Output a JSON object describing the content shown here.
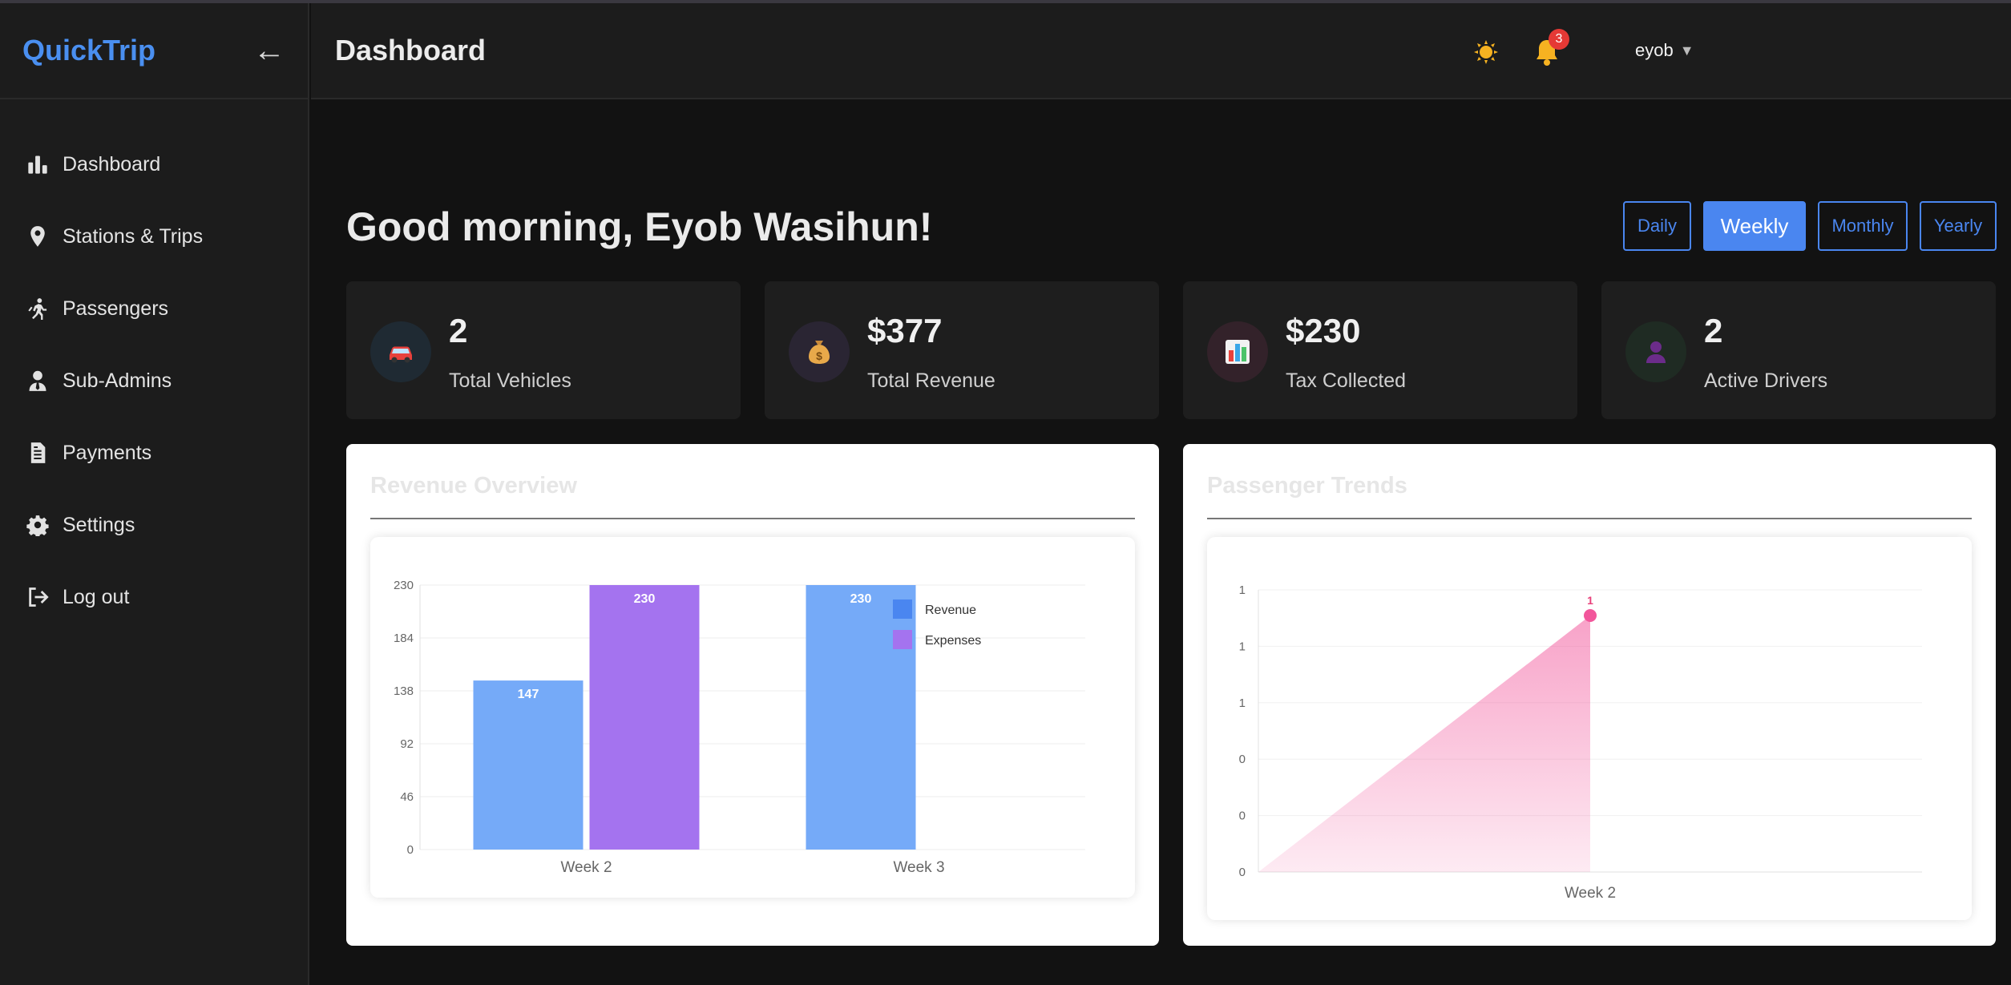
{
  "app": {
    "brand": "QuickTrip",
    "collapse_icon": "arrow-left-icon"
  },
  "sidebar": {
    "items": [
      {
        "label": "Dashboard",
        "icon": "bar-chart-icon"
      },
      {
        "label": "Stations & Trips",
        "icon": "map-pin-icon"
      },
      {
        "label": "Passengers",
        "icon": "walking-person-icon"
      },
      {
        "label": "Sub-Admins",
        "icon": "user-tie-icon"
      },
      {
        "label": "Payments",
        "icon": "document-icon"
      },
      {
        "label": "Settings",
        "icon": "gear-icon"
      },
      {
        "label": "Log out",
        "icon": "logout-icon"
      }
    ]
  },
  "topbar": {
    "title": "Dashboard",
    "notifications_count": "3",
    "username": "eyob",
    "caret": "▼"
  },
  "greeting": "Good morning, Eyob Wasihun!",
  "periods": [
    {
      "label": "Daily",
      "active": false
    },
    {
      "label": "Weekly",
      "active": true
    },
    {
      "label": "Monthly",
      "active": false
    },
    {
      "label": "Yearly",
      "active": false
    }
  ],
  "stats": [
    {
      "value": "2",
      "label": "Total Vehicles",
      "icon": "car-icon"
    },
    {
      "value": "$377",
      "label": "Total Revenue",
      "icon": "money-bag-icon"
    },
    {
      "value": "$230",
      "label": "Tax Collected",
      "icon": "bar-chart-icon"
    },
    {
      "value": "2",
      "label": "Active Drivers",
      "icon": "driver-icon"
    }
  ],
  "colors": {
    "accent": "#4a86f0",
    "revenue": "#75aaf8",
    "expenses": "#a473ef",
    "trend": "#f2569b",
    "badge": "#e53935"
  },
  "charts": {
    "revenue_title": "Revenue Overview",
    "passenger_title": "Passenger Trends"
  },
  "chart_data": [
    {
      "type": "bar",
      "title": "Revenue Overview",
      "categories": [
        "Week 2",
        "Week 3"
      ],
      "series": [
        {
          "name": "Revenue",
          "values": [
            147,
            230
          ]
        },
        {
          "name": "Expenses",
          "values": [
            230,
            0
          ]
        }
      ],
      "yticks": [
        0,
        46,
        92,
        138,
        184,
        230
      ],
      "ylim": [
        0,
        230
      ],
      "legend": "top-right",
      "grid": true
    },
    {
      "type": "area",
      "title": "Passenger Trends",
      "categories": [
        "Week 2"
      ],
      "series": [
        {
          "name": "",
          "values": [
            1
          ]
        }
      ],
      "point_label": "1",
      "yticks": [
        "0",
        "0",
        "0",
        "1",
        "1",
        "1"
      ],
      "grid": true
    }
  ]
}
